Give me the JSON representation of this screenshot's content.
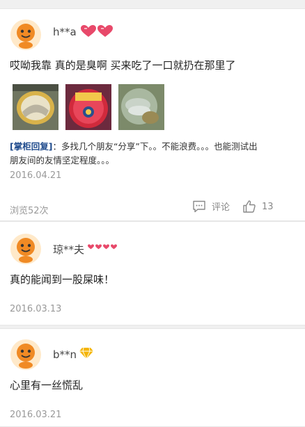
{
  "reviews": [
    {
      "username": "h**a",
      "text": "哎呦我靠 真的是臭啊 买来吃了一口就扔在那里了",
      "reply": {
        "tag": "[掌柜回复]",
        "line1": "：多找几个朋友“分享”下。。不能浪费。。。也能测试出",
        "line2": "朋友间的友情坚定程度。。。"
      },
      "date": "2016.04.21",
      "views": "浏览52次",
      "comment_label": "评论",
      "like_count": "13",
      "badge_icon": "heart-badge-icon"
    },
    {
      "username": "琼**夫",
      "text": "真的能闻到一股屎味！",
      "date": "2016.03.13",
      "badge_icon": "heart-badge-icon"
    },
    {
      "username": "b**n",
      "text": "心里有一丝慌乱",
      "date": "2016.03.21",
      "badge_icon": "diamond-badge-icon"
    }
  ],
  "colors": {
    "avatar": "#f08a24",
    "heart_badge": "#e8496a",
    "diamond_badge": "#f4b400",
    "reply_tag": "#1e4a8c"
  }
}
